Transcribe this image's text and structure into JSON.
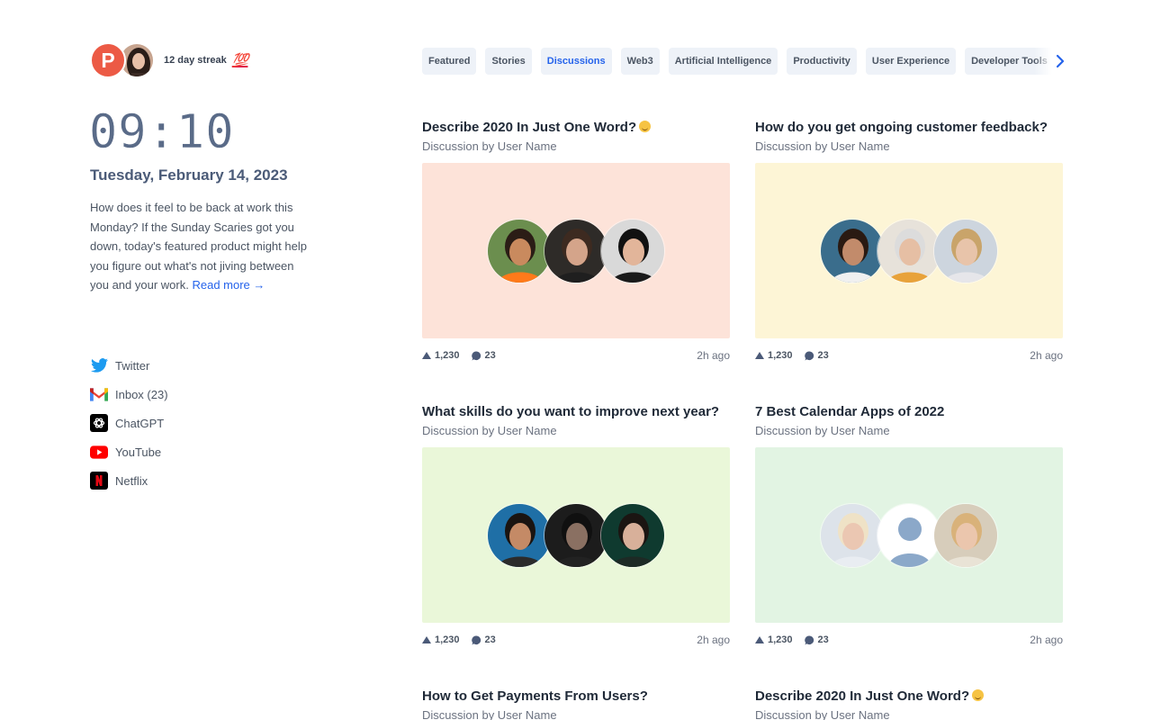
{
  "profile": {
    "logo_letter": "P",
    "streak_text": "12 day streak",
    "streak_emoji": "💯"
  },
  "clock": {
    "time": "09:10",
    "date": "Tuesday, February 14, 2023"
  },
  "blurb": {
    "text": "How does it feel to be back at work this Monday? If the Sunday Scaries got you down, today's featured product might help you figure out what's not jiving between you and your work.",
    "link": "Read more →"
  },
  "links": [
    {
      "label": "Twitter",
      "icon": "twitter-icon"
    },
    {
      "label": "Inbox (23)",
      "icon": "gmail-icon"
    },
    {
      "label": "ChatGPT",
      "icon": "chatgpt-icon"
    },
    {
      "label": "YouTube",
      "icon": "youtube-icon"
    },
    {
      "label": "Netflix",
      "icon": "netflix-icon"
    }
  ],
  "tabs": [
    "Featured",
    "Stories",
    "Discussions",
    "Web3",
    "Artificial Intelligence",
    "Productivity",
    "User Experience",
    "Developer Tools"
  ],
  "active_tab": "Discussions",
  "colors": {
    "accent": "#2563eb",
    "logo": "#ec5a45",
    "card_bg": [
      "#fde3d9",
      "#fdf5d6",
      "#eaf7d9",
      "#e2f4e3"
    ]
  },
  "cards": [
    {
      "title": "Describe 2020 In Just One Word?",
      "emoji": true,
      "subtitle": "Discussion by User Name",
      "votes": "1,230",
      "comments": "23",
      "time": "2h ago"
    },
    {
      "title": "How do you get ongoing customer feedback?",
      "emoji": false,
      "subtitle": "Discussion by User Name",
      "votes": "1,230",
      "comments": "23",
      "time": "2h ago"
    },
    {
      "title": "What skills do you want to improve next year?",
      "emoji": false,
      "subtitle": "Discussion by User Name",
      "votes": "1,230",
      "comments": "23",
      "time": "2h ago"
    },
    {
      "title": "7 Best Calendar Apps of 2022",
      "emoji": false,
      "subtitle": "Discussion by User Name",
      "votes": "1,230",
      "comments": "23",
      "time": "2h ago"
    },
    {
      "title": "How to Get Payments From Users?",
      "emoji": false,
      "subtitle": "Discussion by User Name"
    },
    {
      "title": "Describe 2020 In Just One Word?",
      "emoji": true,
      "subtitle": "Discussion by User Name"
    }
  ]
}
